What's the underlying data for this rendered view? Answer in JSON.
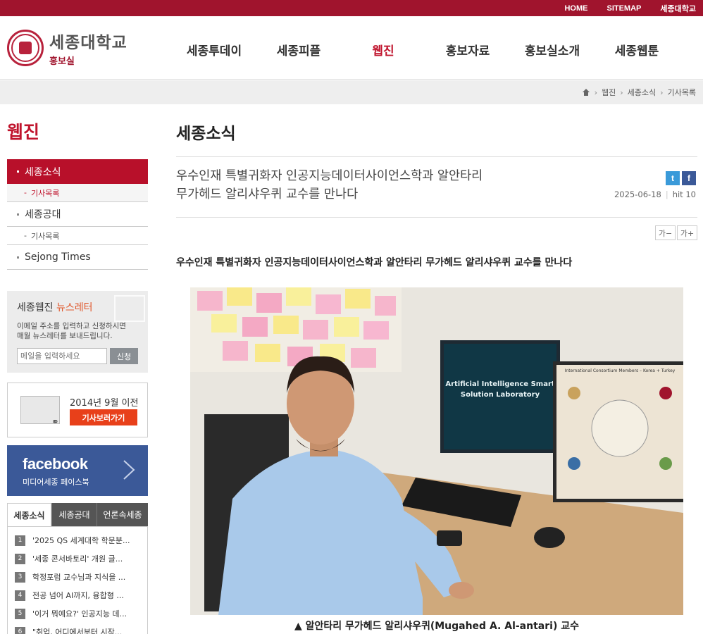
{
  "topbar": {
    "home": "HOME",
    "sitemap": "SITEMAP",
    "univ": "세종대학교"
  },
  "logo": {
    "title": "세종대학교",
    "sub": "홍보실"
  },
  "gnb": [
    "세종투데이",
    "세종피플",
    "웹진",
    "홍보자료",
    "홍보실소개",
    "세종웹툰"
  ],
  "gnb_active_index": 2,
  "breadcrumb": [
    "웹진",
    "세종소식",
    "기사목록"
  ],
  "lnb": {
    "title": "웹진",
    "items": [
      {
        "label": "세종소식",
        "sub": "기사목록"
      },
      {
        "label": "세종공대",
        "sub": "기사목록"
      },
      {
        "label": "Sejong Times"
      }
    ]
  },
  "newsletter": {
    "title_a": "세종웹진 ",
    "title_b": "뉴스레터",
    "desc1": "이메일 주소를 입력하고 신청하시면",
    "desc2": "매월 뉴스레터를 보내드립니다.",
    "placeholder": "메일을 입력하세요",
    "button": "신청"
  },
  "archive": {
    "label": "2014년 9월 이전",
    "button": "기사보러가기"
  },
  "facebook": {
    "title": "facebook",
    "sub": "미디어세종 페이스북"
  },
  "tabs": {
    "labels": [
      "세종소식",
      "세종공대",
      "언론속세종"
    ],
    "rows": [
      {
        "n": "1",
        "text": "'2025 QS 세계대학 학문분..."
      },
      {
        "n": "2",
        "text": "'세종 콘서바토리' 개원 글..."
      },
      {
        "n": "3",
        "text": "학정포럼 교수님과 지식을 ..."
      },
      {
        "n": "4",
        "text": "전공 넘어 AI까지, 융합형 ..."
      },
      {
        "n": "5",
        "text": "'이거 뭐예요?' 인공지능 데..."
      },
      {
        "n": "6",
        "text": "\"취업, 어디에서부터 시작..."
      }
    ]
  },
  "main": {
    "section_title": "세종소식",
    "title_line1": "우수인재 특별귀화자 인공지능데이터사이언스학과 알안타리",
    "title_line2": "무가헤드 알리샤우퀴 교수를 만나다",
    "date": "2025-06-18",
    "hit": "hit  10",
    "font_minus": "가−",
    "font_plus": "가+",
    "headline": "우수인재 특별귀화자 인공지능데이터사이언스학과 알안타리 무가헤드 알리샤우퀴 교수를 만나다",
    "caption": "▲ 알안타리 무가헤드 알리샤우퀴(Mugahed A. Al-antari) 교수",
    "monitor_text": "Artificial Intelligence Smart Solution Laboratory",
    "poster_text": "International Consortium Members – Korea + Turkey"
  },
  "colors": {
    "brand": "#a0142d",
    "accent": "#c0142d",
    "facebook": "#3b5998",
    "twitter": "#3a9ad9",
    "orange": "#e8401a"
  }
}
